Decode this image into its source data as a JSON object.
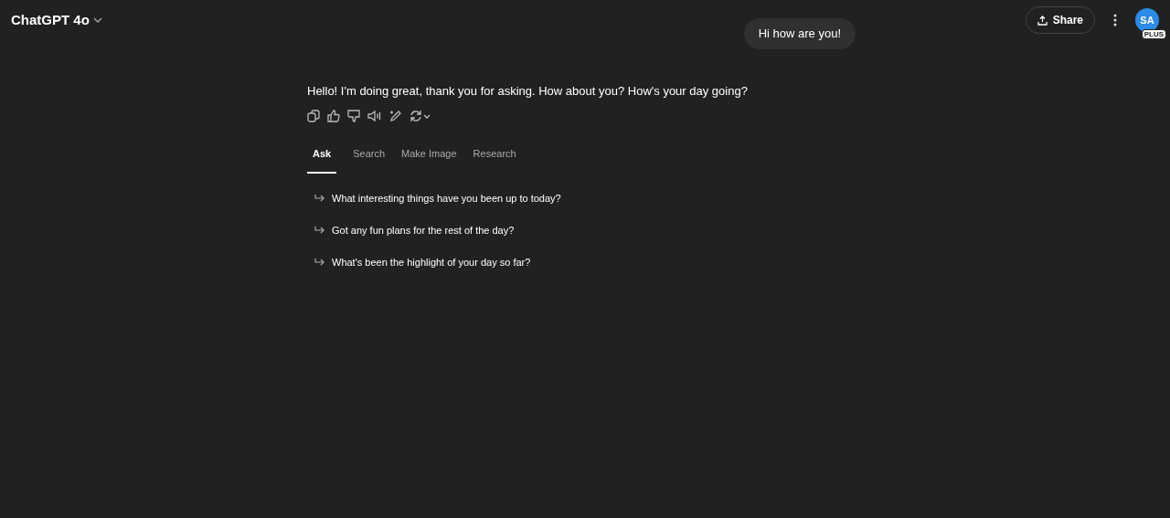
{
  "header": {
    "model": "ChatGPT 4o",
    "share": "Share",
    "avatar": "SA",
    "plan_badge": "PLUS"
  },
  "user_message": "Hi how are you!",
  "assistant_message": "Hello! I'm doing great, thank you for asking. How about you? How's your day going?",
  "tabs": [
    {
      "label": "Ask",
      "selected": true
    },
    {
      "label": "Search",
      "selected": false
    },
    {
      "label": "Make Image",
      "selected": false
    },
    {
      "label": "Research",
      "selected": false
    }
  ],
  "suggestions": [
    "What interesting things have you been up to today?",
    "Got any fun plans for the rest of the day?",
    "What's been the highlight of your day so far?"
  ]
}
